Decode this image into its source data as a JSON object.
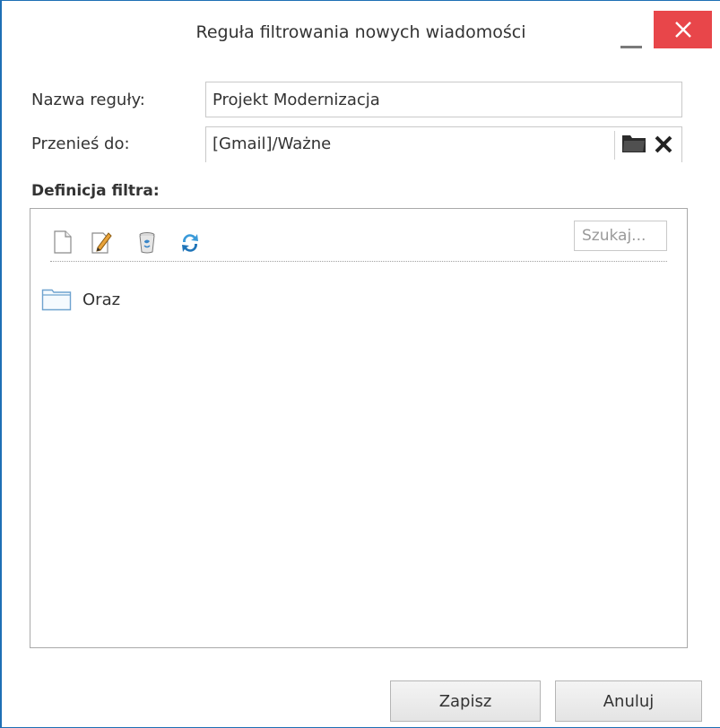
{
  "window": {
    "title": "Reguła filtrowania nowych wiadomości"
  },
  "form": {
    "name_label": "Nazwa reguły:",
    "name_value": "Projekt Modernizacja",
    "move_label": "Przenieś do:",
    "move_value": "[Gmail]/Ważne"
  },
  "filter": {
    "section_title": "Definicja filtra:",
    "toolbar": {
      "icons": [
        "new-document-icon",
        "edit-icon",
        "delete-icon",
        "refresh-icon"
      ],
      "search_placeholder": "Szukaj..."
    },
    "tree": [
      {
        "label": "Oraz",
        "icon": "folder-icon"
      }
    ]
  },
  "buttons": {
    "save_label": "Zapisz",
    "cancel_label": "Anuluj"
  },
  "colors": {
    "close_button": "#e8464a",
    "window_border": "#1e6fb5"
  }
}
